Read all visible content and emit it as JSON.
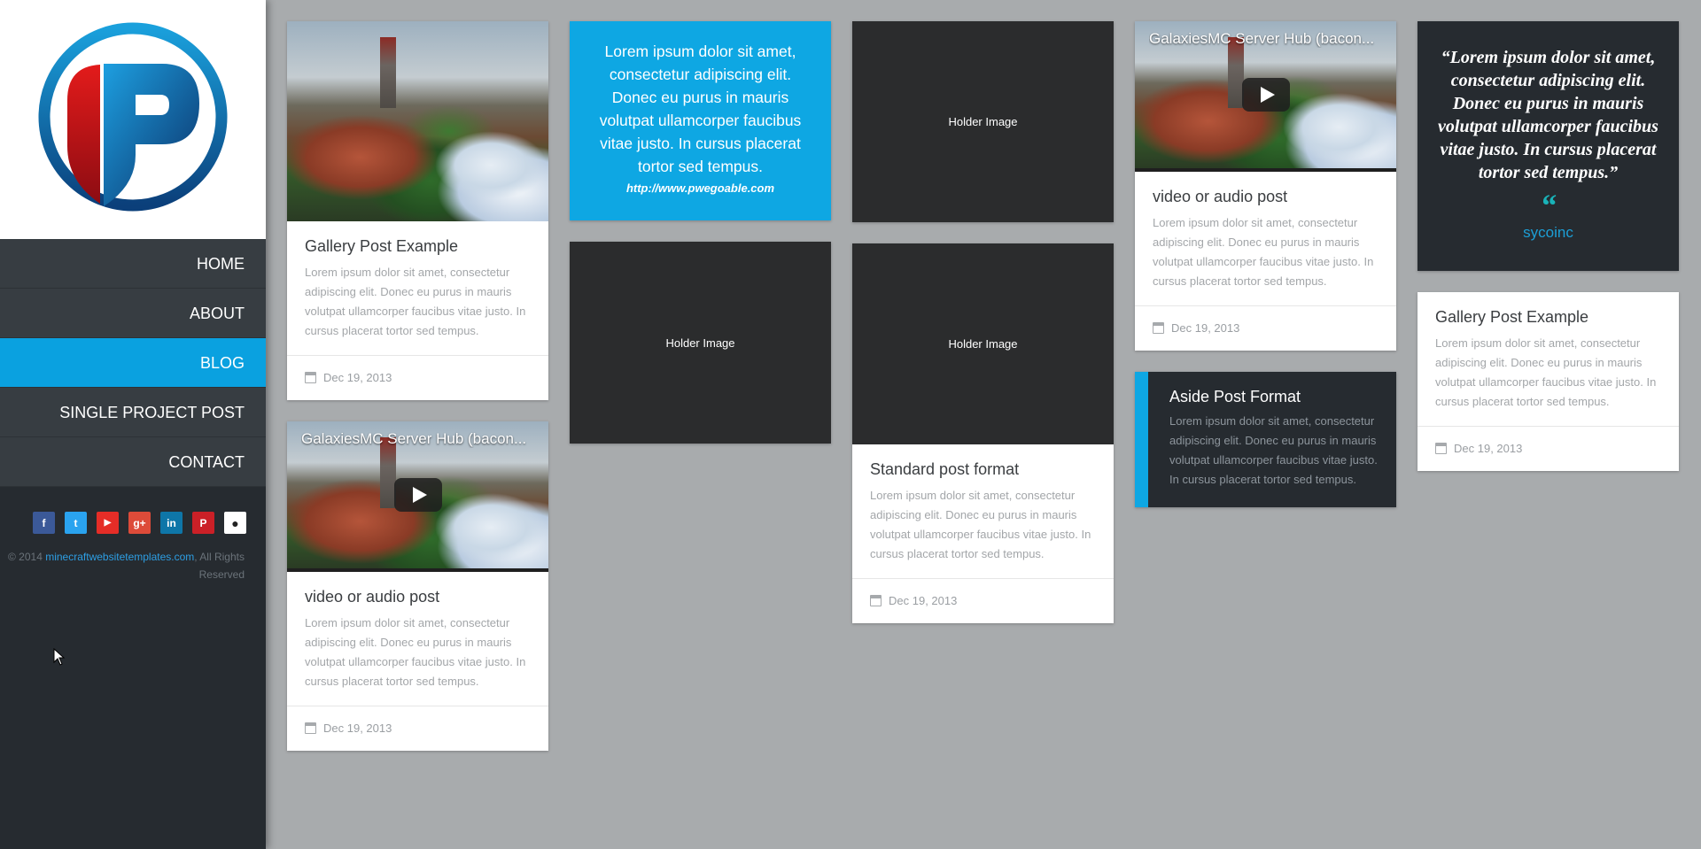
{
  "sidebar": {
    "nav": [
      {
        "label": "HOME",
        "active": false
      },
      {
        "label": "ABOUT",
        "active": false
      },
      {
        "label": "BLOG",
        "active": true
      },
      {
        "label": "SINGLE PROJECT POST",
        "active": false
      },
      {
        "label": "CONTACT",
        "active": false
      }
    ],
    "social": [
      {
        "icon": "facebook-icon",
        "glyph": "f",
        "color": "#3b5998"
      },
      {
        "icon": "twitter-icon",
        "glyph": "t",
        "color": "#2aa3ef"
      },
      {
        "icon": "youtube-icon",
        "glyph": "▶",
        "color": "#e52d27"
      },
      {
        "icon": "google-plus-icon",
        "glyph": "g+",
        "color": "#dd4b39"
      },
      {
        "icon": "linkedin-icon",
        "glyph": "in",
        "color": "#0e76a8"
      },
      {
        "icon": "pinterest-icon",
        "glyph": "P",
        "color": "#cb2027"
      },
      {
        "icon": "github-icon",
        "glyph": "●",
        "color": "#ffffff"
      }
    ],
    "copyright_prefix": "© 2014",
    "copyright_link": "minecraftwebsitetemplates.com",
    "copyright_suffix": ", All Rights Reserved"
  },
  "posts": {
    "gallery1": {
      "title": "Gallery Post Example",
      "text": "Lorem ipsum dolor sit amet, consectetur adipiscing elit. Donec eu purus in mauris volutpat ullamcorper faucibus vitae justo. In cursus placerat tortor sed tempus.",
      "date": "Dec 19, 2013"
    },
    "video1": {
      "video_title": "GalaxiesMC Server Hub (bacon...",
      "title": "video or audio post",
      "text": "Lorem ipsum dolor sit amet, consectetur adipiscing elit. Donec eu purus in mauris volutpat ullamcorper faucibus vitae justo. In cursus placerat tortor sed tempus.",
      "date": "Dec 19, 2013"
    },
    "quote_blue": {
      "text": "Lorem ipsum dolor sit amet, consectetur adipiscing elit. Donec eu purus in mauris volutpat ullamcorper faucibus vitae justo. In cursus placerat tortor sed tempus.",
      "link": "http://www.pwegoable.com"
    },
    "holder1": {
      "label": "Holder Image"
    },
    "holder2": {
      "label": "Holder Image"
    },
    "standard": {
      "holder": "Holder Image",
      "title": "Standard post format",
      "text": "Lorem ipsum dolor sit amet, consectetur adipiscing elit. Donec eu purus in mauris volutpat ullamcorper faucibus vitae justo. In cursus placerat tortor sed tempus.",
      "date": "Dec 19, 2013"
    },
    "video2": {
      "video_title": "GalaxiesMC Server Hub (bacon...",
      "title": "video or audio post",
      "text": "Lorem ipsum dolor sit amet, consectetur adipiscing elit. Donec eu purus in mauris volutpat ullamcorper faucibus vitae justo. In cursus placerat tortor sed tempus.",
      "date": "Dec 19, 2013"
    },
    "aside": {
      "title": "Aside Post Format",
      "text": "Lorem ipsum dolor sit amet, consectetur adipiscing elit. Donec eu purus in mauris volutpat ullamcorper faucibus vitae justo. In cursus placerat tortor sed tempus."
    },
    "quote_dark": {
      "text": "“Lorem ipsum dolor sit amet, consectetur adipiscing elit. Donec eu purus in mauris volutpat ullamcorper faucibus vitae justo. In cursus placerat tortor sed tempus.”",
      "mark": "“",
      "author": "sycoinc"
    },
    "gallery2": {
      "title": "Gallery Post Example",
      "text": "Lorem ipsum dolor sit amet, consectetur adipiscing elit. Donec eu purus in mauris volutpat ullamcorper faucibus vitae justo. In cursus placerat tortor sed tempus.",
      "date": "Dec 19, 2013"
    }
  }
}
